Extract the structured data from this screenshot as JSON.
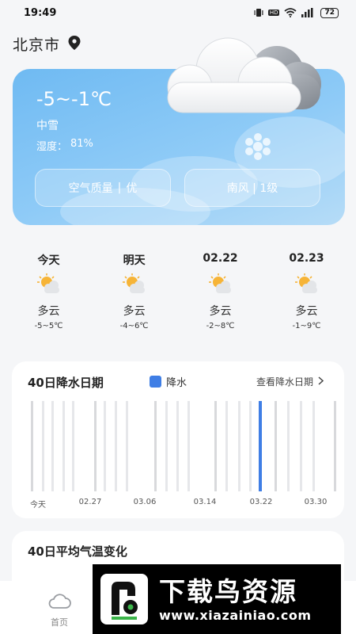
{
  "status_bar": {
    "time": "19:49",
    "battery": "72",
    "hd": "HD"
  },
  "location": {
    "city": "北京市",
    "icon": "location-pin-icon"
  },
  "current": {
    "temp_range": "-5~-1℃",
    "condition": "中雪",
    "humidity_label": "湿度：",
    "humidity_value": "81%",
    "aqi_label": "空气质量",
    "aqi_sep": "|",
    "aqi_value": "优",
    "wind": "南风 | 1级"
  },
  "forecast": [
    {
      "label": "今天",
      "condition": "多云",
      "temp": "-5~5℃",
      "icon": "partly-cloudy-icon"
    },
    {
      "label": "明天",
      "condition": "多云",
      "temp": "-4~6℃",
      "icon": "partly-cloudy-icon"
    },
    {
      "label": "02.22",
      "condition": "多云",
      "temp": "-2~8℃",
      "icon": "partly-cloudy-icon"
    },
    {
      "label": "02.23",
      "condition": "多云",
      "temp": "-1~9℃",
      "icon": "partly-cloudy-icon"
    }
  ],
  "precipitation": {
    "title": "40日降水日期",
    "legend": "降水",
    "view_link": "查看降水日期",
    "dates": [
      "今天",
      "02.27",
      "03.06",
      "03.14",
      "03.22",
      "03.30"
    ],
    "rain_color": "#3f7ee5"
  },
  "temperature": {
    "title": "40日平均气温变化"
  },
  "nav": {
    "home": "首页"
  },
  "watermark": {
    "title": "下载鸟资源",
    "url": "www.xiazainiao.com"
  }
}
